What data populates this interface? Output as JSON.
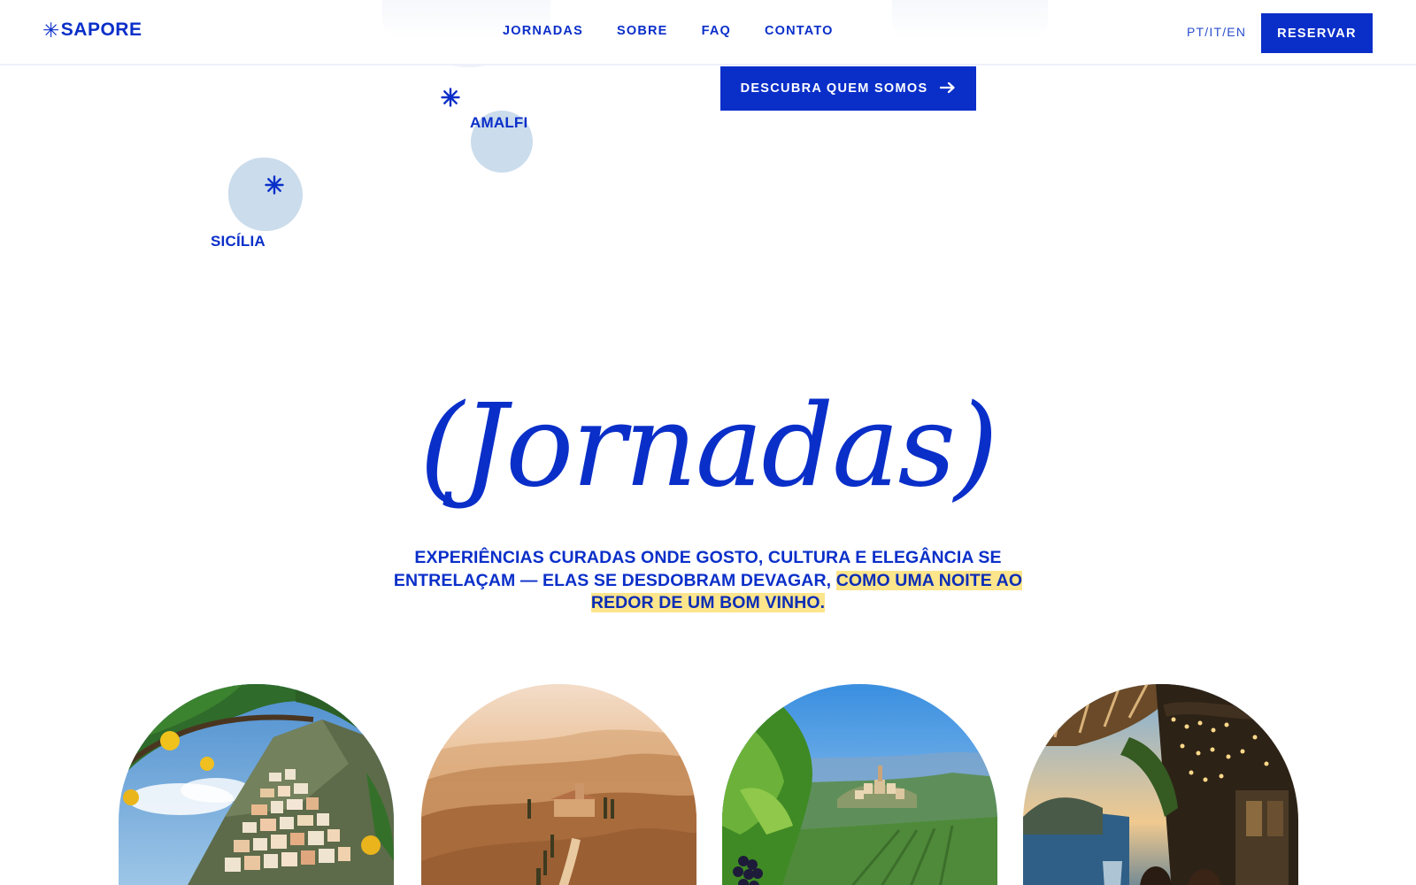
{
  "header": {
    "logo_symbol": "✳",
    "logo_text": "SAPORE",
    "nav": [
      "JORNADAS",
      "SOBRE",
      "FAQ",
      "CONTATO"
    ],
    "lang": "PT/IT/EN",
    "cta": "RESERVAR"
  },
  "hero": {
    "cta_label": "DESCUBRA QUEM SOMOS",
    "cta_icon": "arrow-right-icon",
    "map": {
      "marker_icon": "asterisk-icon",
      "labels": [
        "AMALFI",
        "SICÍLIA"
      ]
    }
  },
  "journeys": {
    "title": "(Jornadas)",
    "intro_plain": "EXPERIÊNCIAS CURADAS ONDE GOSTO, CULTURA E ELEGÂNCIA SE ENTRELAÇAM — ELAS SE DESDOBRAM DEVAGAR, ",
    "intro_highlight": "COMO UMA NOITE AO REDOR DE UM BOM VINHO.",
    "cards": [
      {
        "image": "amalfi-coast-lemons"
      },
      {
        "image": "tuscany-hills-villa"
      },
      {
        "image": "vineyard-hilltop-village"
      },
      {
        "image": "seaside-restaurant-terrace"
      }
    ]
  },
  "colors": {
    "brand_blue": "#0a2fc9",
    "map_blob": "#cbdcec",
    "highlight": "#fde58c",
    "background": "#ffffff"
  }
}
